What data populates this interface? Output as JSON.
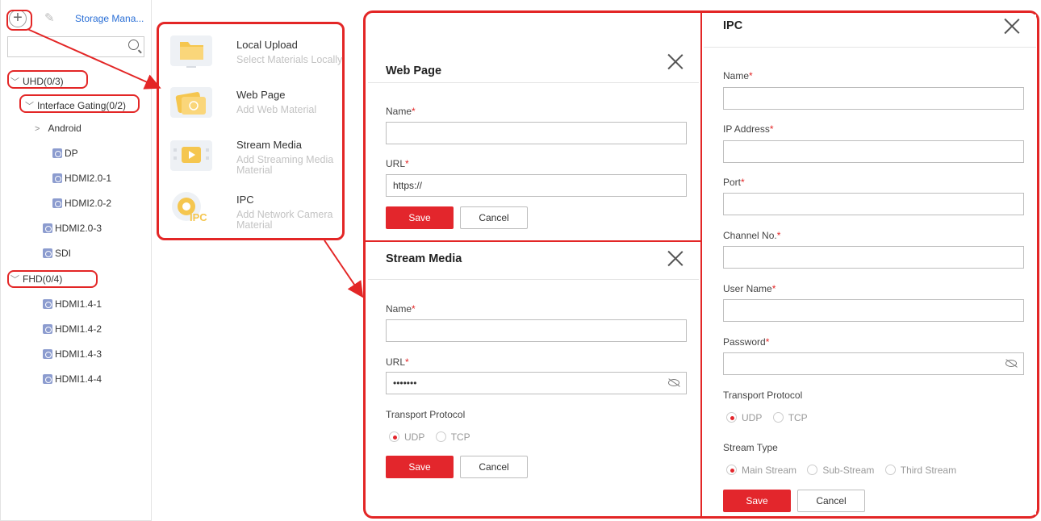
{
  "sidebar": {
    "add_icon": "plus-icon",
    "edit_icon": "pencil-icon",
    "storage_link": "Storage Mana...",
    "search_placeholder": "",
    "tree": {
      "uhd": "UHD(0/3)",
      "interface_gating": "Interface Gating(0/2)",
      "android": "Android",
      "dp": "DP",
      "hdmi20_1": "HDMI2.0-1",
      "hdmi20_2": "HDMI2.0-2",
      "hdmi20_3": "HDMI2.0-3",
      "sdi": "SDI",
      "fhd": "FHD(0/4)",
      "hdmi14_1": "HDMI1.4-1",
      "hdmi14_2": "HDMI1.4-2",
      "hdmi14_3": "HDMI1.4-3",
      "hdmi14_4": "HDMI1.4-4"
    }
  },
  "material_menu": {
    "local_upload": {
      "title": "Local Upload",
      "sub": "Select Materials Locally"
    },
    "web_page": {
      "title": "Web Page",
      "sub": "Add Web Material"
    },
    "stream_media": {
      "title": "Stream Media",
      "sub": "Add Streaming Media Material"
    },
    "ipc": {
      "title": "IPC",
      "sub": "Add Network Camera Material"
    }
  },
  "web_dialog": {
    "title": "Web Page",
    "name_label": "Name",
    "url_label": "URL",
    "name_value": "",
    "url_value": "https://",
    "save": "Save",
    "cancel": "Cancel"
  },
  "stream_dialog": {
    "title": "Stream Media",
    "name_label": "Name",
    "url_label": "URL",
    "name_value": "",
    "url_value": "•••••••",
    "protocol_label": "Transport Protocol",
    "udp": "UDP",
    "tcp": "TCP",
    "save": "Save",
    "cancel": "Cancel"
  },
  "ipc_dialog": {
    "title": "IPC",
    "name_label": "Name",
    "ip_label": "IP Address",
    "port_label": "Port",
    "channel_label": "Channel No.",
    "user_label": "User Name",
    "password_label": "Password",
    "protocol_label": "Transport Protocol",
    "udp": "UDP",
    "tcp": "TCP",
    "stream_type_label": "Stream Type",
    "main_stream": "Main Stream",
    "sub_stream": "Sub-Stream",
    "third_stream": "Third Stream",
    "save": "Save",
    "cancel": "Cancel"
  },
  "colors": {
    "accent": "#e3262c",
    "link": "#2a6fd6",
    "annotation": "#e32626"
  }
}
